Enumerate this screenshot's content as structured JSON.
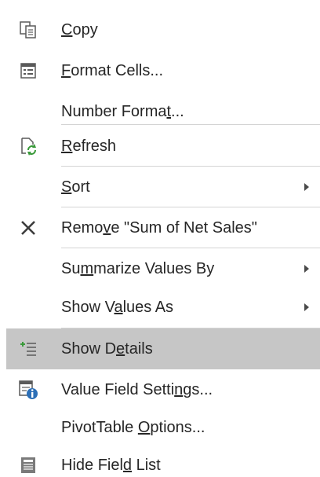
{
  "menu": {
    "items": [
      {
        "pre": "",
        "key": "C",
        "post": "opy",
        "icon": "copy-icon"
      },
      {
        "pre": "",
        "key": "F",
        "post": "ormat Cells...",
        "icon": "format-cells-icon"
      },
      {
        "pre": "Number Forma",
        "key": "t",
        "post": "...",
        "icon": ""
      },
      {
        "pre": "",
        "key": "R",
        "post": "efresh",
        "icon": "refresh-icon"
      },
      {
        "pre": "",
        "key": "S",
        "post": "ort",
        "icon": "",
        "submenu": true
      },
      {
        "pre": "Remo",
        "key": "v",
        "post": "e \"Sum of Net Sales\"",
        "icon": "remove-x-icon"
      },
      {
        "pre": "Su",
        "key": "m",
        "post": "marize Values By",
        "icon": "",
        "submenu": true
      },
      {
        "pre": "Show V",
        "key": "a",
        "post": "lues As",
        "icon": "",
        "submenu": true
      },
      {
        "pre": "Show D",
        "key": "e",
        "post": "tails",
        "icon": "show-details-icon",
        "highlighted": true
      },
      {
        "pre": "Value Field Setti",
        "key": "n",
        "post": "gs...",
        "icon": "value-field-settings-icon"
      },
      {
        "pre": "PivotTable ",
        "key": "O",
        "post": "ptions...",
        "icon": ""
      },
      {
        "pre": "Hide Fiel",
        "key": "d",
        "post": " List",
        "icon": "field-list-icon"
      }
    ]
  },
  "colors": {
    "text": "#262626",
    "highlight": "#c6c6c6",
    "separator": "#d4d4d4",
    "refresh_green": "#3a9a3a",
    "info_blue": "#2c6fb7"
  }
}
